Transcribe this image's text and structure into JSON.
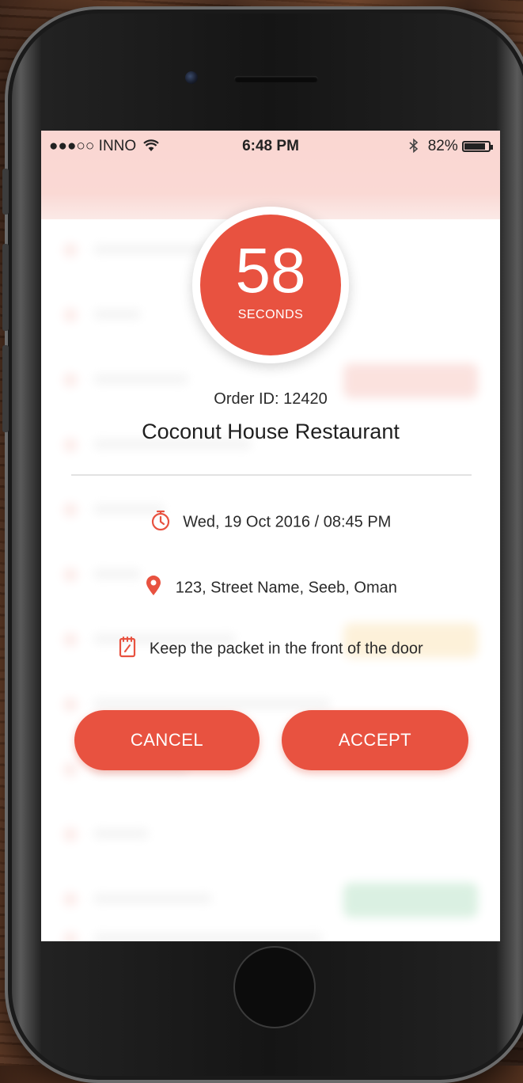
{
  "status_bar": {
    "carrier": "●●●○○ INNO",
    "time": "6:48 PM",
    "battery": "82%"
  },
  "timer": {
    "value": "58",
    "unit": "SECONDS"
  },
  "order": {
    "id_text": "Order ID: 12420",
    "restaurant": "Coconut House Restaurant",
    "datetime": "Wed, 19 Oct 2016 / 08:45 PM",
    "address": "123, Street Name, Seeb, Oman",
    "note": "Keep the packet in the front of the door"
  },
  "actions": {
    "cancel_label": "CANCEL",
    "accept_label": "ACCEPT"
  },
  "icons": {
    "datetime": "stopwatch-icon",
    "address": "location-pin-icon",
    "note": "notepad-icon"
  },
  "colors": {
    "accent": "#e85240",
    "header": "#f3a59b"
  }
}
